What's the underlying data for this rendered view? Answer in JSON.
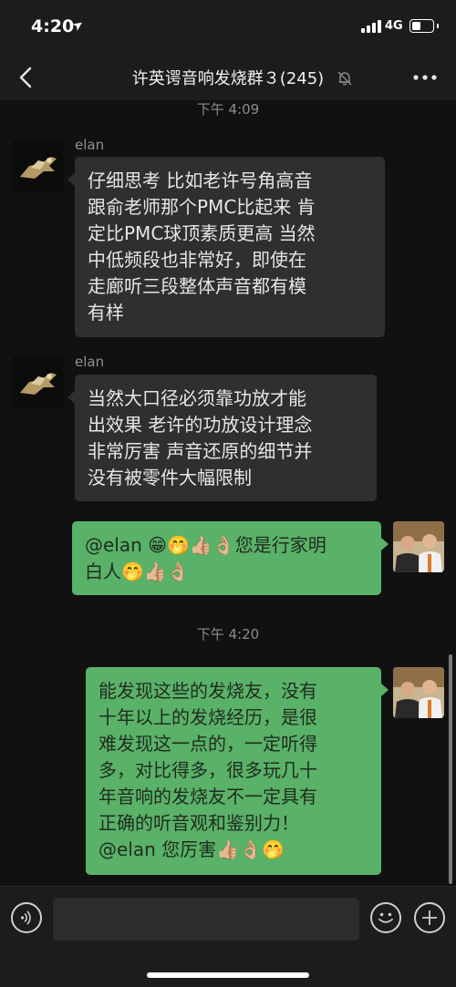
{
  "status_bar": {
    "time": "4:20",
    "location_arrow": "➤",
    "network": "4G",
    "battery_level": 0.45
  },
  "nav": {
    "title": "许英谔音响发烧群３(245)",
    "back_icon": "chevron-left-icon",
    "mute_icon": "bell-slash-icon",
    "more_icon": "ellipsis-icon"
  },
  "messages": {
    "timestamp_top": "下午 4:09",
    "msg1": {
      "sender": "elan",
      "text": "仔细思考 比如老许号角高音\n跟俞老师那个PMC比起来 肯\n定比PMC球顶素质更高 当然\n中低频段也非常好，即使在\n走廊听三段整体声音都有模\n有样"
    },
    "msg2": {
      "sender": "elan",
      "text": "当然大口径必须靠功放才能\n出效果 老许的功放设计理念\n非常厉害 声音还原的细节并\n没有被零件大幅限制"
    },
    "msg3": {
      "text": "@elan 😁🤭👍🏼👌🏼您是行家明\n白人🤭👍🏼👌🏼"
    },
    "timestamp_mid": "下午 4:20",
    "msg4": {
      "text": "能发现这些的发烧友，没有\n十年以上的发烧经历，是很\n难发现这一点的，一定听得\n多，对比得多，很多玩几十\n年音响的发烧友不一定具有\n正确的听音观和鉴别力！\n@elan 您厉害👍🏼👌🏼🤭"
    }
  },
  "input_bar": {
    "voice_icon": "voice-icon",
    "emoji_icon": "smiley-icon",
    "plus_icon": "plus-icon",
    "input_value": ""
  },
  "colors": {
    "background": "#111111",
    "bar": "#1c1c1c",
    "incoming_bubble": "#2f2f2f",
    "outgoing_bubble": "#5ab168"
  }
}
